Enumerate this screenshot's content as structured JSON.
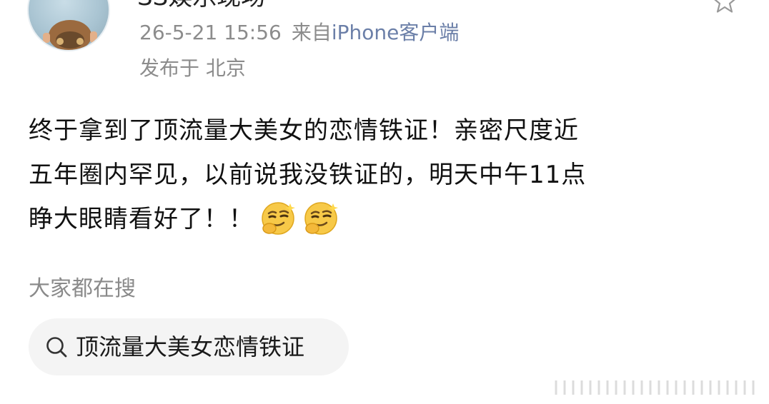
{
  "post": {
    "author_name": "SS娱乐现场",
    "timestamp": "26-5-21 15:56",
    "source_prefix": "来自",
    "source_device": "iPhone客户端",
    "location": "发布于 北京",
    "text_lines": [
      "终于拿到了顶流量大美女的恋情铁证！亲密尺度近",
      "五年圈内罕见，以前说我没铁证的，明天中午11点",
      "睁大眼睛看好了！！"
    ],
    "emojis": [
      "smirk-emoji",
      "smirk-emoji"
    ]
  },
  "trending": {
    "title": "大家都在搜",
    "query": "顶流量大美女恋情铁证"
  },
  "icons": {
    "favorite": "star-icon",
    "search": "search-icon"
  },
  "colors": {
    "text_primary": "#111111",
    "text_secondary": "#8c8c8c",
    "device_link": "#6b7fa8",
    "pill_background": "#f4f4f4"
  }
}
